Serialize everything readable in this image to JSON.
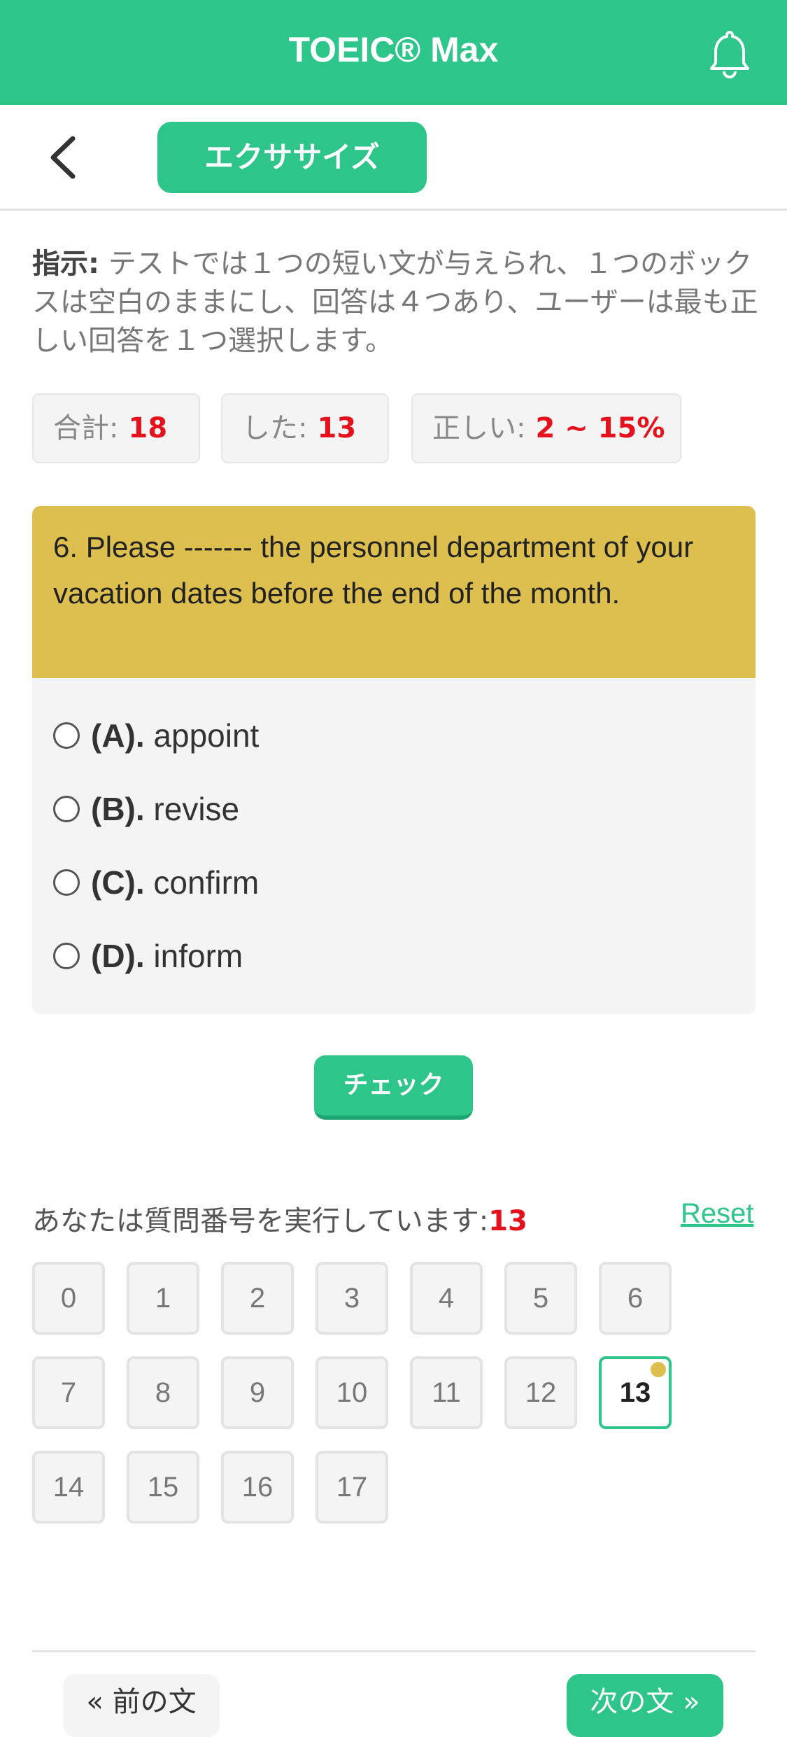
{
  "header": {
    "title": "TOEIC® Max",
    "bell_icon": "bell-icon"
  },
  "subnav": {
    "back_icon": "chevron-left-icon",
    "mode_label": "エクササイズ"
  },
  "instruction": {
    "label": "指示:",
    "text": " テストでは１つの短い文が与えられ、１つのボックスは空白のままにし、回答は４つあり、ユーザーは最も正しい回答を１つ選択します。"
  },
  "stats": {
    "total_label": "合計:",
    "total_value": "18",
    "done_label": "した:",
    "done_value": "13",
    "correct_label": "正しい:",
    "correct_value": "2 ~ 15%"
  },
  "question": {
    "text": "6. Please ------- the personnel department of your vacation dates before the end of the month.",
    "options": [
      {
        "letter": "(A).",
        "text": "appoint"
      },
      {
        "letter": "(B).",
        "text": "revise"
      },
      {
        "letter": "(C).",
        "text": "confirm"
      },
      {
        "letter": "(D).",
        "text": "inform"
      }
    ]
  },
  "check_label": "チェック",
  "progress": {
    "label": "あなたは質問番号を実行しています:",
    "current": "13",
    "reset_label": "Reset",
    "numbers": [
      "0",
      "1",
      "2",
      "3",
      "4",
      "5",
      "6",
      "7",
      "8",
      "9",
      "10",
      "11",
      "12",
      "13",
      "14",
      "15",
      "16",
      "17"
    ]
  },
  "footer": {
    "prev_label": "« 前の文",
    "next_label": "次の文 »"
  },
  "colors": {
    "brand": "#2dc58a",
    "question_bg": "#dcbf4f",
    "highlight": "#e5111c"
  }
}
